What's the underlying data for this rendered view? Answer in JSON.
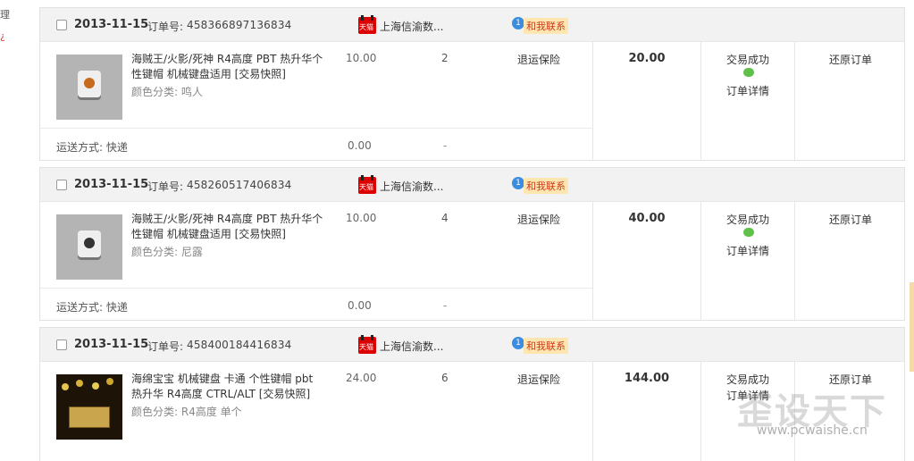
{
  "left_edge": {
    "glyph_top": "理",
    "glyph_bottom": "¿"
  },
  "orders": [
    {
      "date": "2013-11-15",
      "order_label": "订单号:",
      "order_number": "458366897136834",
      "shop_badge": "天猫",
      "shop_name": "上海信渝数...",
      "contact_label": "和我联系",
      "item_title": "海贼王/火影/死神 R4高度 PBT 热升华个性键帽 机械键盘适用 [交易快照]",
      "item_color": "颜色分类: 鸣人",
      "price": "10.00",
      "quantity": "2",
      "service": "退运保险",
      "total": "20.00",
      "status": "交易成功",
      "detail_link": "订单详情",
      "action": "还原订单",
      "ship_label": "运送方式: 快递",
      "ship_fee": "0.00",
      "ship_dash": "-"
    },
    {
      "date": "2013-11-15",
      "order_label": "订单号:",
      "order_number": "458260517406834",
      "shop_badge": "天猫",
      "shop_name": "上海信渝数...",
      "contact_label": "和我联系",
      "item_title": "海贼王/火影/死神 R4高度 PBT 热升华个性键帽 机械键盘适用 [交易快照]",
      "item_color": "颜色分类: 尼露",
      "price": "10.00",
      "quantity": "4",
      "service": "退运保险",
      "total": "40.00",
      "status": "交易成功",
      "detail_link": "订单详情",
      "action": "还原订单",
      "ship_label": "运送方式: 快递",
      "ship_fee": "0.00",
      "ship_dash": "-"
    },
    {
      "date": "2013-11-15",
      "order_label": "订单号:",
      "order_number": "458400184416834",
      "shop_badge": "天猫",
      "shop_name": "上海信渝数...",
      "contact_label": "和我联系",
      "item_title": "海绵宝宝 机械键盘 卡通 个性键帽 pbt热升华 R4高度 CTRL/ALT [交易快照]",
      "item_color": "颜色分类: R4高度 单个",
      "price": "24.00",
      "quantity": "6",
      "service": "退运保险",
      "total": "144.00",
      "status": "交易成功",
      "detail_link": "订单详情",
      "action": "还原订单"
    }
  ],
  "watermark": {
    "big": "歪设天下",
    "small": "www.pcwaishe.cn"
  },
  "icons": {
    "checkbox": "checkbox-icon",
    "shop_badge": "tmall-icon",
    "contact": "chat-bubble-icon",
    "wangwang": "wangwang-icon"
  }
}
